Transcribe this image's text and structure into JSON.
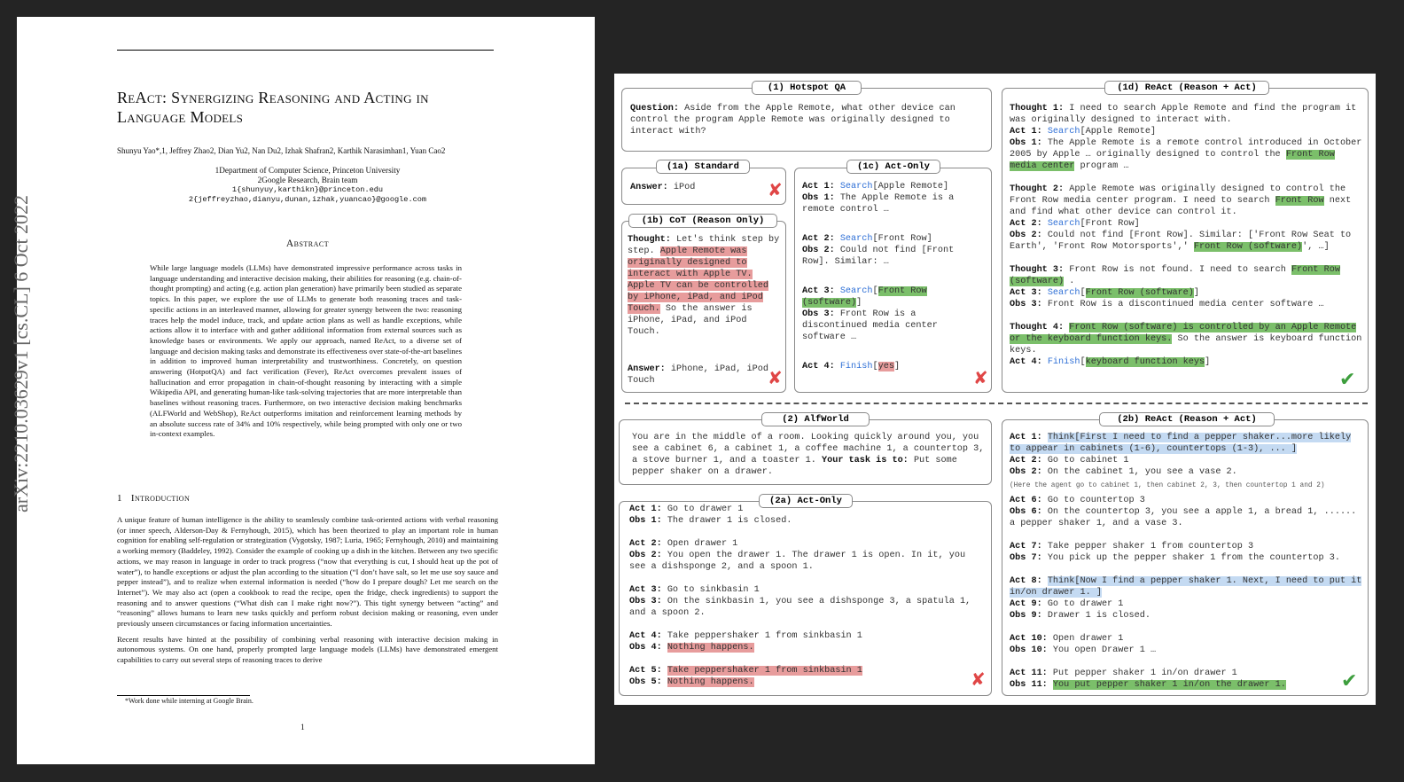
{
  "paper": {
    "arxiv_id": "arXiv:2210.03629v1  [cs.CL]  6 Oct 2022",
    "title": "ReAct: Synergizing Reasoning and Acting in Language Models",
    "authors": "Shunyu Yao*,1, Jeffrey Zhao2, Dian Yu2, Nan Du2, Izhak Shafran2, Karthik Narasimhan1, Yuan Cao2",
    "affiliation_1": "1Department of Computer Science, Princeton University",
    "affiliation_2": "2Google Research, Brain team",
    "email_1": "1{shunyuy,karthikn}@princeton.edu",
    "email_2": "2{jeffreyzhao,dianyu,dunan,izhak,yuancao}@google.com",
    "abstract_heading": "Abstract",
    "abstract": "While large language models (LLMs) have demonstrated impressive performance across tasks in language understanding and interactive decision making, their abilities for reasoning (e.g. chain-of-thought prompting) and acting (e.g. action plan generation) have primarily been studied as separate topics. In this paper, we explore the use of LLMs to generate both reasoning traces and task-specific actions in an interleaved manner, allowing for greater synergy between the two: reasoning traces help the model induce, track, and update action plans as well as handle exceptions, while actions allow it to interface with and gather additional information from external sources such as knowledge bases or environments. We apply our approach, named ReAct, to a diverse set of language and decision making tasks and demonstrate its effectiveness over state-of-the-art baselines in addition to improved human interpretability and trustworthiness. Concretely, on question answering (HotpotQA) and fact verification (Fever), ReAct overcomes prevalent issues of hallucination and error propagation in chain-of-thought reasoning by interacting with a simple Wikipedia API, and generating human-like task-solving trajectories that are more interpretable than baselines without reasoning traces. Furthermore, on two interactive decision making benchmarks (ALFWorld and WebShop), ReAct outperforms imitation and reinforcement learning methods by an absolute success rate of 34% and 10% respectively, while being prompted with only one or two in-context examples.",
    "intro_number": "1",
    "intro_heading": "Introduction",
    "intro_p1": "A unique feature of human intelligence is the ability to seamlessly combine task-oriented actions with verbal reasoning (or inner speech, Alderson-Day & Fernyhough, 2015), which has been theorized to play an important role in human cognition for enabling self-regulation or strategization (Vygotsky, 1987; Luria, 1965; Fernyhough, 2010) and maintaining a working memory (Baddeley, 1992). Consider the example of cooking up a dish in the kitchen. Between any two specific actions, we may reason in language in order to track progress (“now that everything is cut, I should heat up the pot of water”), to handle exceptions or adjust the plan according to the situation (“I don’t have salt, so let me use soy sauce and pepper instead”), and to realize when external information is needed (“how do I prepare dough? Let me search on the Internet”). We may also act (open a cookbook to read the recipe, open the fridge, check ingredients) to support the reasoning and to answer questions (“What dish can I make right now?”). This tight synergy between “acting” and “reasoning” allows humans to learn new tasks quickly and perform robust decision making or reasoning, even under previously unseen circumstances or facing information uncertainties.",
    "intro_p2": "Recent results have hinted at the possibility of combining verbal reasoning with interactive decision making in autonomous systems. On one hand, properly prompted large language models (LLMs) have demonstrated emergent capabilities to carry out several steps of reasoning traces to derive",
    "footnote": "*Work done while interning at Google Brain.",
    "page_number": "1"
  },
  "figure": {
    "hotpot_label": "(1) Hotspot QA",
    "question_key": "Question:",
    "question": "Aside from the Apple Remote, what other device can control the program Apple Remote was originally designed to interact with?",
    "standard_label": "(1a) Standard",
    "standard_answer_key": "Answer:",
    "standard_answer": "iPod",
    "cot_label": "(1b) CoT (Reason Only)",
    "cot_thought_key": "Thought:",
    "cot_thought_pre": "Let's think step by step.",
    "cot_thought_hl": "Apple Remote was originally designed to interact with Apple TV. Apple TV can be controlled by iPhone, iPad, and iPod Touch.",
    "cot_thought_post": "So the answer is iPhone, iPad, and iPod Touch.",
    "cot_answer_key": "Answer:",
    "cot_answer": "iPhone, iPad, iPod Touch",
    "actonly_label": "(1c) Act-Only",
    "c_act1_key": "Act 1:",
    "c_act1_fn": "Search",
    "c_act1_arg": "[Apple Remote]",
    "c_obs1_key": "Obs 1:",
    "c_obs1": "The Apple Remote is a remote control …",
    "c_act2_key": "Act 2:",
    "c_act2_fn": "Search",
    "c_act2_arg": "[Front Row]",
    "c_obs2_key": "Obs 2:",
    "c_obs2": "Could not find [Front Row]. Similar: …",
    "c_act3_key": "Act 3:",
    "c_act3_fn": "Search",
    "c_act3_open": "[",
    "c_act3_hl": "Front Row (software)",
    "c_act3_close": "]",
    "c_obs3_key": "Obs 3:",
    "c_obs3": "Front Row is a discontinued media center software …",
    "c_act4_key": "Act 4:",
    "c_act4_fn": "Finish",
    "c_act4_open": "[",
    "c_act4_hl": "yes",
    "c_act4_close": "]",
    "react1_label": "(1d) ReAct (Reason + Act)",
    "d_t1_key": "Thought 1:",
    "d_t1": "I need to search Apple Remote and find the program it was originally designed to interact with.",
    "d_a1_key": "Act 1:",
    "d_a1_fn": "Search",
    "d_a1_arg": "[Apple Remote]",
    "d_o1_key": "Obs 1:",
    "d_o1": "The Apple Remote is a remote control introduced in October 2005 by Apple … originally designed to control the",
    "d_o1_hl": "Front Row media center",
    "d_o1_post": "program …",
    "d_t2_key": "Thought 2:",
    "d_t2": "Apple Remote was originally designed to control the Front Row media center program. I need to search",
    "d_t2_hl": "Front Row",
    "d_t2_post": "next and find what other device can control it.",
    "d_a2_key": "Act 2:",
    "d_a2_fn": "Search",
    "d_a2_arg": "[Front Row]",
    "d_o2_key": "Obs 2:",
    "d_o2": "Could not find [Front Row]. Similar: ['Front Row Seat to Earth', 'Front Row Motorsports',' ",
    "d_o2_hl1": "Front Row (software)",
    "d_o2_post": "', …]",
    "d_t3_key": "Thought 3:",
    "d_t3": "Front Row is not found. I need to search",
    "d_t3_hl": "Front Row (software)",
    "d_t3_post": ".",
    "d_a3_key": "Act 3:",
    "d_a3_fn": "Search",
    "d_a3_open": "[",
    "d_a3_hl": "Front Row (software)",
    "d_a3_close": "]",
    "d_o3_key": "Obs 3:",
    "d_o3": "Front Row is a discontinued media center software …",
    "d_t4_key": "Thought 4:",
    "d_t4_hl": "Front Row (software) is controlled by an Apple Remote or the keyboard function keys.",
    "d_t4_post": "So the answer is keyboard function keys.",
    "d_a4_key": "Act 4:",
    "d_a4_fn": "Finish",
    "d_a4_open": "[",
    "d_a4_hl": "keyboard function keys",
    "d_a4_close": "]",
    "alf_label": "(2) AlfWorld",
    "alf_desc": "You are in the middle of a room. Looking quickly around you, you see a cabinet 6, a cabinet 1, a coffee machine 1, a countertop 3, a stove burner 1, and a toaster 1.",
    "alf_task_key": "Your task is to:",
    "alf_task": "Put some pepper shaker on a drawer.",
    "a2_label": "(2a) Act-Only",
    "a2_act1_key": "Act 1:",
    "a2_act1": "Go to drawer 1",
    "a2_obs1_key": "Obs 1:",
    "a2_obs1": "The drawer 1 is closed.",
    "a2_act2_key": "Act 2:",
    "a2_act2": "Open drawer 1",
    "a2_obs2_key": "Obs 2:",
    "a2_obs2": "You open the drawer 1. The drawer 1 is open. In it, you see a dishsponge 2, and a spoon 1.",
    "a2_act3_key": "Act 3:",
    "a2_act3": "Go to sinkbasin 1",
    "a2_obs3_key": "Obs 3:",
    "a2_obs3": "On the sinkbasin 1, you see a dishsponge 3, a spatula 1, and a spoon 2.",
    "a2_act4_key": "Act 4:",
    "a2_act4": "Take peppershaker 1 from sinkbasin 1",
    "a2_obs4_key": "Obs 4:",
    "a2_obs4_hl": "Nothing happens.",
    "a2_act5_key": "Act 5:",
    "a2_act5_hl": "Take peppershaker 1 from sinkbasin 1",
    "a2_obs5_key": "Obs 5:",
    "a2_obs5_hl": "Nothing happens.",
    "b2_label": "(2b) ReAct (Reason + Act)",
    "b2_act1_key": "Act 1:",
    "b2_act1_fn": "Think",
    "b2_act1_hl": "[First I need to find a pepper shaker...more likely to appear in cabinets (1-6), countertops (1-3), ... ]",
    "b2_act2_key": "Act 2:",
    "b2_act2": "Go to cabinet 1",
    "b2_obs2_key": "Obs 2:",
    "b2_obs2": "On the cabinet 1, you see a vase 2.",
    "b2_note": "(Here the agent go to cabinet 1, then cabinet 2, 3, then countertop 1 and 2)",
    "b2_act6_key": "Act 6:",
    "b2_act6": "Go to countertop 3",
    "b2_obs6_key": "Obs 6:",
    "b2_obs6": "On the countertop 3, you see a apple 1, a bread 1, ...... a pepper shaker 1, and a vase 3.",
    "b2_act7_key": "Act 7:",
    "b2_act7": "Take pepper shaker 1 from countertop 3",
    "b2_obs7_key": "Obs 7:",
    "b2_obs7": "You pick up the pepper shaker 1 from the countertop 3.",
    "b2_act8_key": "Act 8:",
    "b2_act8_fn": "Think",
    "b2_act8_hl": "[Now I find a pepper shaker 1. Next, I need to put it in/on drawer 1. ]",
    "b2_act9_key": "Act 9:",
    "b2_act9": "Go to drawer 1",
    "b2_obs9_key": "Obs 9:",
    "b2_obs9": "Drawer 1 is closed.",
    "b2_act10_key": "Act 10:",
    "b2_act10": "Open drawer 1",
    "b2_obs10_key": "Obs 10:",
    "b2_obs10": "You open Drawer 1 …",
    "b2_act11_key": "Act 11:",
    "b2_act11": "Put pepper shaker 1 in/on drawer 1",
    "b2_obs11_key": "Obs 11:",
    "b2_obs11_hl": "You put pepper shaker 1 in/on the drawer 1.",
    "wrong_mark": "✘",
    "right_mark": "✔"
  },
  "colors": {
    "wrong_highlight": "#e79c9c",
    "right_highlight": "#7bbf6a",
    "think_highlight": "#c4daf2",
    "function_text": "#2e6fd6",
    "wrong_mark": "#e04646",
    "right_mark": "#3d9e3d"
  }
}
